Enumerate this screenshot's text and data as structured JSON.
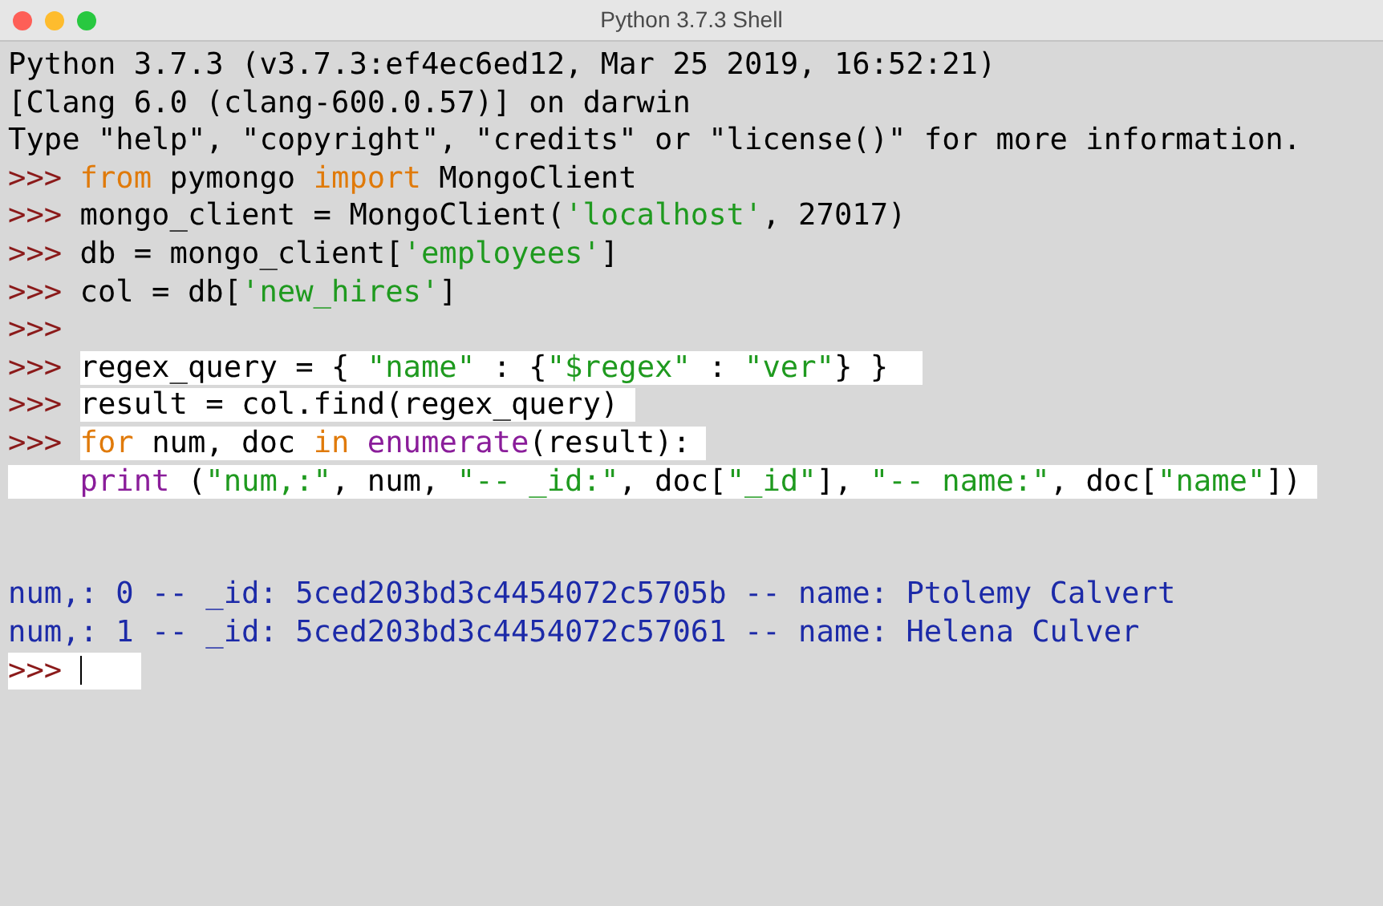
{
  "window": {
    "title": "Python 3.7.3 Shell"
  },
  "lines": [
    {
      "kind": "text",
      "highlighted": false,
      "tokens": [
        {
          "text": "Python 3.7.3 (v3.7.3:ef4ec6ed12, Mar 25 2019, 16:52:21)",
          "kind": "plain"
        }
      ]
    },
    {
      "kind": "text",
      "highlighted": false,
      "tokens": [
        {
          "text": "[Clang 6.0 (clang-600.0.57)] on darwin",
          "kind": "plain"
        }
      ]
    },
    {
      "kind": "text",
      "highlighted": false,
      "tokens": [
        {
          "text": "Type \"help\", \"copyright\", \"credits\" or \"license()\" for more information.",
          "kind": "plain"
        }
      ]
    },
    {
      "kind": "text",
      "prompt": {
        "text": ">>>",
        "highlighted": false
      },
      "highlighted": false,
      "tokens": [
        {
          "text": "from",
          "kind": "keyword"
        },
        {
          "text": " pymongo ",
          "kind": "plain"
        },
        {
          "text": "import",
          "kind": "keyword"
        },
        {
          "text": " MongoClient",
          "kind": "plain"
        }
      ]
    },
    {
      "kind": "text",
      "prompt": {
        "text": ">>>",
        "highlighted": false
      },
      "highlighted": false,
      "tokens": [
        {
          "text": "mongo_client = MongoClient(",
          "kind": "plain"
        },
        {
          "text": "'localhost'",
          "kind": "string"
        },
        {
          "text": ", 27017)",
          "kind": "plain"
        }
      ]
    },
    {
      "kind": "text",
      "prompt": {
        "text": ">>>",
        "highlighted": false
      },
      "highlighted": false,
      "tokens": [
        {
          "text": "db = mongo_client[",
          "kind": "plain"
        },
        {
          "text": "'employees'",
          "kind": "string"
        },
        {
          "text": "]",
          "kind": "plain"
        }
      ]
    },
    {
      "kind": "text",
      "prompt": {
        "text": ">>>",
        "highlighted": false
      },
      "highlighted": false,
      "tokens": [
        {
          "text": "col = db[",
          "kind": "plain"
        },
        {
          "text": "'new_hires'",
          "kind": "string"
        },
        {
          "text": "]",
          "kind": "plain"
        }
      ]
    },
    {
      "kind": "prompt_only",
      "prompt": {
        "text": ">>>",
        "highlighted": false
      }
    },
    {
      "kind": "text",
      "prompt": {
        "text": ">>>",
        "highlighted": false
      },
      "highlighted": true,
      "tokens": [
        {
          "text": "regex_query = { ",
          "kind": "plain"
        },
        {
          "text": "\"name\"",
          "kind": "string"
        },
        {
          "text": " : {",
          "kind": "plain"
        },
        {
          "text": "\"$regex\"",
          "kind": "string"
        },
        {
          "text": " : ",
          "kind": "plain"
        },
        {
          "text": "\"ver\"",
          "kind": "string"
        },
        {
          "text": "} } ",
          "kind": "plain"
        }
      ]
    },
    {
      "kind": "text",
      "prompt": {
        "text": ">>>",
        "highlighted": false
      },
      "highlighted": true,
      "tokens": [
        {
          "text": "result = col.find(regex_query)",
          "kind": "plain"
        }
      ]
    },
    {
      "kind": "text",
      "prompt": {
        "text": ">>>",
        "highlighted": false
      },
      "highlighted": true,
      "tokens": [
        {
          "text": "for",
          "kind": "keyword"
        },
        {
          "text": " num, doc ",
          "kind": "plain"
        },
        {
          "text": "in",
          "kind": "keyword"
        },
        {
          "text": " enumerate",
          "kind": "builtin"
        },
        {
          "text": "(result):",
          "kind": "plain"
        }
      ]
    },
    {
      "kind": "continuation",
      "highlighted": true,
      "tokens": [
        {
          "text": "print",
          "kind": "builtin"
        },
        {
          "text": " (",
          "kind": "plain"
        },
        {
          "text": "\"num,:\"",
          "kind": "string"
        },
        {
          "text": ", num, ",
          "kind": "plain"
        },
        {
          "text": "\"-- _id:\"",
          "kind": "string"
        },
        {
          "text": ", doc[",
          "kind": "plain"
        },
        {
          "text": "\"_id\"",
          "kind": "string"
        },
        {
          "text": "], ",
          "kind": "plain"
        },
        {
          "text": "\"-- name:\"",
          "kind": "string"
        },
        {
          "text": ", doc[",
          "kind": "plain"
        },
        {
          "text": "\"name\"",
          "kind": "string"
        },
        {
          "text": "])",
          "kind": "plain"
        }
      ]
    },
    {
      "kind": "blank"
    },
    {
      "kind": "blank"
    },
    {
      "kind": "output",
      "highlighted": false,
      "tokens": [
        {
          "text": "num,: 0 -- _id: 5ced203bd3c4454072c5705b -- name: Ptolemy Calvert",
          "kind": "output"
        }
      ]
    },
    {
      "kind": "output",
      "highlighted": false,
      "tokens": [
        {
          "text": "num,: 1 -- _id: 5ced203bd3c4454072c57061 -- name: Helena Culver",
          "kind": "output"
        }
      ]
    },
    {
      "kind": "cursor",
      "prompt": {
        "text": ">>>",
        "highlighted": true
      }
    }
  ]
}
